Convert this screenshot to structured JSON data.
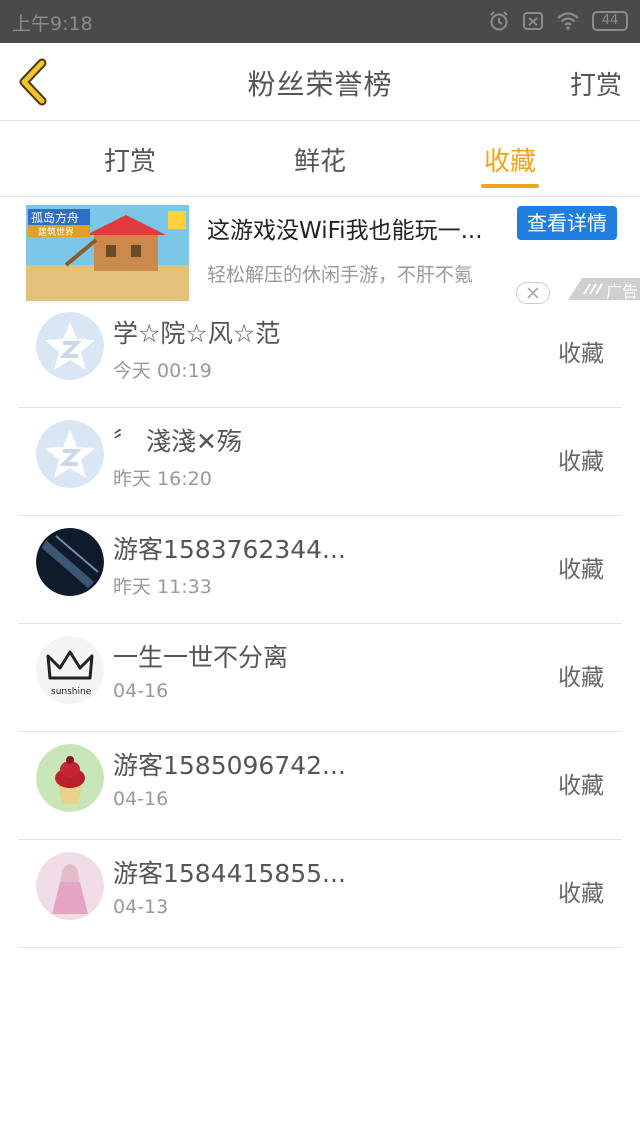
{
  "status_bar": {
    "time": "上午9:18",
    "battery": "44"
  },
  "nav": {
    "title": "粉丝荣誉榜",
    "right_action": "打赏"
  },
  "tabs": [
    {
      "label": "打赏",
      "active": false
    },
    {
      "label": "鲜花",
      "active": false
    },
    {
      "label": "收藏",
      "active": true
    }
  ],
  "ad": {
    "image_caption_line1": "孤岛方舟",
    "image_caption_line2": "建筑世界",
    "title": "这游戏没WiFi我也能玩一...",
    "button": "查看详情",
    "description": "轻松解压的休闲手游，不肝不氪",
    "tag": "广告"
  },
  "fans": [
    {
      "name": "学☆院☆风☆范",
      "time": "今天 00:19",
      "type": "收藏",
      "avatar": "default-qq-star"
    },
    {
      "name": "〞 淺淺✕殇",
      "time": "昨天 16:20",
      "type": "收藏",
      "avatar": "default-qq-star"
    },
    {
      "name": "游客1583762344...",
      "time": "昨天 11:33",
      "type": "收藏",
      "avatar": "dark-light-beam"
    },
    {
      "name": "一生一世不分离",
      "time": "04-16",
      "type": "收藏",
      "avatar": "crown-sunshine"
    },
    {
      "name": "游客1585096742...",
      "time": "04-16",
      "type": "收藏",
      "avatar": "cupcake"
    },
    {
      "name": "游客1584415855...",
      "time": "04-13",
      "type": "收藏",
      "avatar": "anime-girl"
    }
  ],
  "colors": {
    "accent": "#f0a417",
    "ad_button": "#1f7ee0",
    "status_bar": "#4a4a4a"
  },
  "crown_text": "sunshine"
}
